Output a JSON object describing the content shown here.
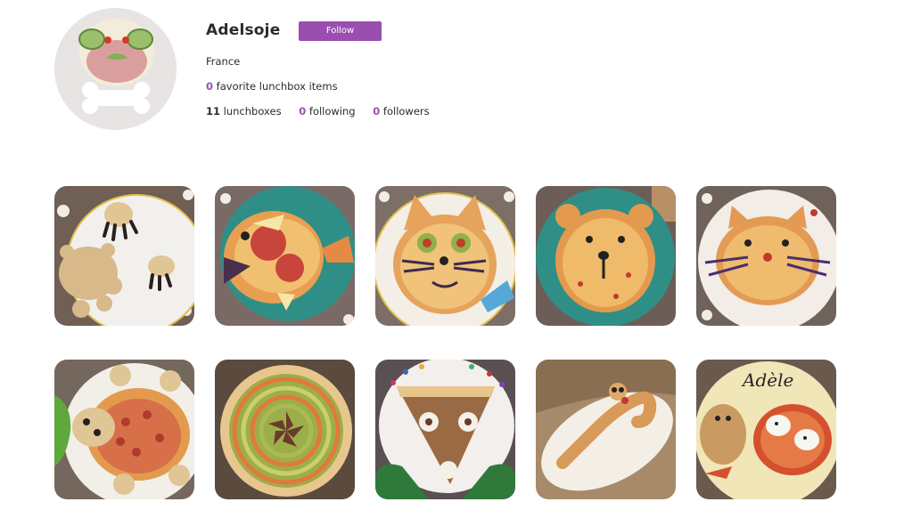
{
  "profile": {
    "username": "Adelsoje",
    "follow_label": "Follow",
    "country": "France",
    "favorites_count": "0",
    "favorites_label": "favorite lunchbox items",
    "lunchboxes_count": "11",
    "lunchboxes_label": "lunchboxes",
    "following_count": "0",
    "following_label": "following",
    "followers_count": "0",
    "followers_label": "followers"
  },
  "colors": {
    "accent": "#9a4fb0",
    "text": "#2b2b2b"
  },
  "lunchboxes": [
    {
      "photo": "dough-turtle-and-spiders"
    },
    {
      "photo": "fish-pizza"
    },
    {
      "photo": "cat-pizza-with-fish"
    },
    {
      "photo": "bear-pizza"
    },
    {
      "photo": "cat-pizza"
    },
    {
      "photo": "turtle-pizza"
    },
    {
      "photo": "vegetable-spiral-tart"
    },
    {
      "photo": "owl-tart-slice"
    },
    {
      "photo": "snake-bread"
    },
    {
      "photo": "cat-bread-with-mice",
      "text": "Adèle"
    }
  ]
}
